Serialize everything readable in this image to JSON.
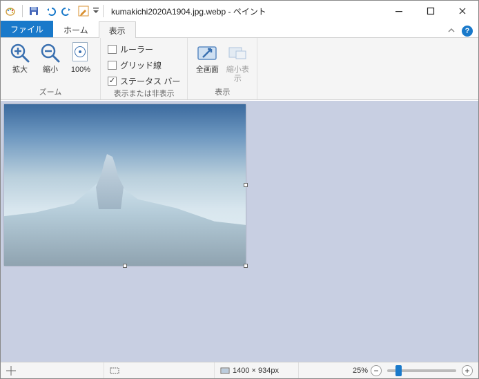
{
  "title": "kumakichi2020A1904.jpg.webp - ペイント",
  "tabs": {
    "file": "ファイル",
    "home": "ホーム",
    "view": "表示"
  },
  "ribbon": {
    "zoom_group": {
      "label": "ズーム",
      "zoom_in": "拡大",
      "zoom_out": "縮小",
      "zoom_100": "100%"
    },
    "showhide_group": {
      "label": "表示または非表示",
      "rulers": "ルーラー",
      "grid": "グリッド線",
      "status_bar": "ステータス バー"
    },
    "display_group": {
      "label": "表示",
      "full_screen": "全画面",
      "thumbnail": "縮小表示"
    }
  },
  "status": {
    "position_icon": "crosshair-icon",
    "selection_icon": "selection-rect-icon",
    "canvas_icon": "canvas-size-icon",
    "canvas_size": "1400 × 934px",
    "zoom_pct": "25%"
  },
  "checkboxes": {
    "rulers": false,
    "grid": false,
    "status_bar": true
  }
}
